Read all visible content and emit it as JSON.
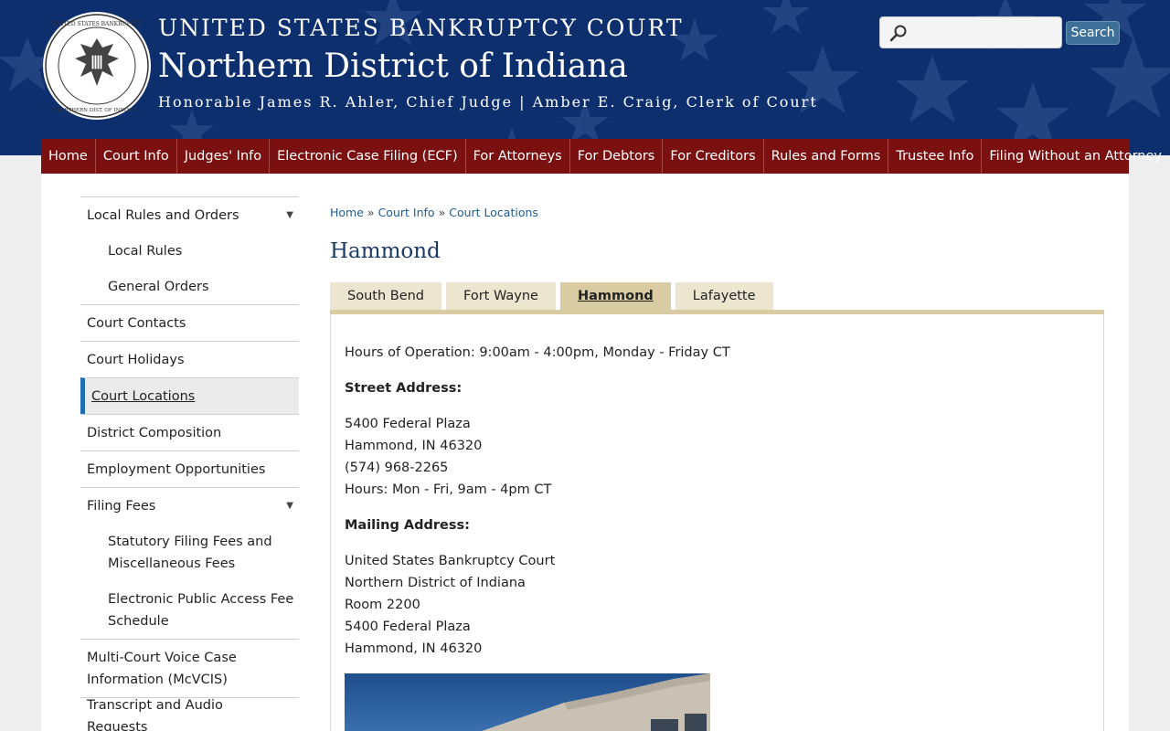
{
  "header": {
    "line1": "UNITED STATES BANKRUPTCY COURT",
    "line2": "Northern District of Indiana",
    "line3": "Honorable James R. Ahler, Chief Judge | Amber E. Craig, Clerk of Court",
    "seal_text_top": "UNITED STATES BANKRUPTCY COURT",
    "seal_text_bottom": "NORTHERN DISTRICT OF INDIANA"
  },
  "search": {
    "placeholder": "",
    "value": "",
    "button_label": "Search"
  },
  "nav": [
    "Home",
    "Court Info",
    "Judges' Info",
    "Electronic Case Filing (ECF)",
    "For Attorneys",
    "For Debtors",
    "For Creditors",
    "Rules and Forms",
    "Trustee Info",
    "Filing Without an Attorney"
  ],
  "sidebar": {
    "local_rules": "Local Rules and Orders",
    "local_rules_sub": [
      "Local Rules",
      "General Orders"
    ],
    "court_contacts": "Court Contacts",
    "court_holidays": "Court Holidays",
    "court_locations": "Court Locations",
    "district_composition": "District Composition",
    "employment": "Employment Opportunities",
    "filing_fees": "Filing Fees",
    "filing_fees_sub": [
      "Statutory Filing Fees and",
      "Miscellaneous Fees",
      "Electronic Public Access Fee",
      "Schedule"
    ],
    "mcvcis": [
      "Multi-Court Voice Case",
      "Information (McVCIS)"
    ],
    "transcript": "Transcript and Audio Requests",
    "expand_glyph": "▼"
  },
  "breadcrumb": [
    "Home",
    "Court Info",
    "Court Locations"
  ],
  "breadcrumb_sep": "»",
  "page_title": "Hammond",
  "tabs": [
    "South Bend",
    "Fort Wayne",
    "Hammond",
    "Lafayette"
  ],
  "active_tab": "Hammond",
  "content": {
    "hours_of_operation": "Hours of Operation: 9:00am - 4:00pm, Monday - Friday CT",
    "street_heading": "Street Address:",
    "street_lines": [
      "5400 Federal Plaza",
      "Hammond, IN 46320",
      "(574) 968-2265",
      "Hours: Mon - Fri, 9am - 4pm CT"
    ],
    "mailing_heading": "Mailing Address:",
    "mailing_lines": [
      "United States Bankruptcy Court",
      "Northern District of Indiana",
      "Room 2200",
      "5400 Federal Plaza",
      "Hammond, IN 46320"
    ]
  },
  "colors": {
    "header_bg": "#0d2f6e",
    "nav_bg": "#7a1010",
    "link": "#1f5c96",
    "tab_bg": "#ece5cf",
    "tab_active": "#d9cca3",
    "sidebar_active_bar": "#1f6fb0"
  }
}
